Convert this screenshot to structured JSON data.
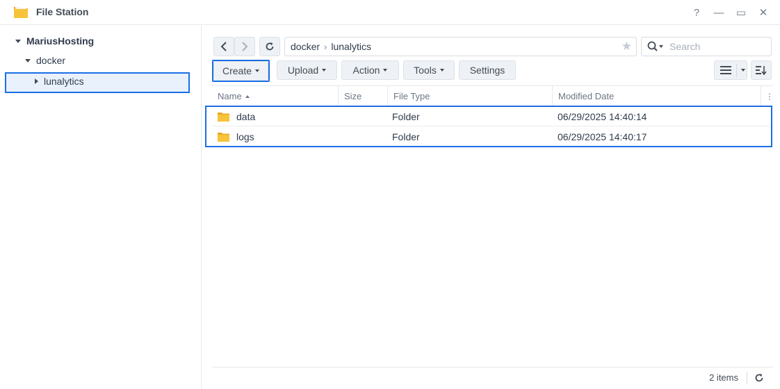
{
  "window": {
    "title": "File Station",
    "controls": [
      "?",
      "—",
      "▭",
      "✕"
    ]
  },
  "sidebar": {
    "items": [
      {
        "label": "MariusHosting",
        "expanded": true,
        "level": 0
      },
      {
        "label": "docker",
        "expanded": true,
        "level": 1
      },
      {
        "label": "lunalytics",
        "expanded": false,
        "level": 2,
        "selected": true
      }
    ]
  },
  "pathbar": {
    "segments": [
      "docker",
      "lunalytics"
    ],
    "separator": "›"
  },
  "search": {
    "placeholder": "Search",
    "value": ""
  },
  "toolbar": {
    "create_label": "Create",
    "upload_label": "Upload",
    "action_label": "Action",
    "tools_label": "Tools",
    "settings_label": "Settings"
  },
  "table": {
    "columns": [
      "Name",
      "Size",
      "File Type",
      "Modified Date"
    ],
    "sort_column": "Name",
    "rows": [
      {
        "name": "data",
        "size": "",
        "type": "Folder",
        "modified": "06/29/2025 14:40:14"
      },
      {
        "name": "logs",
        "size": "",
        "type": "Folder",
        "modified": "06/29/2025 14:40:17"
      }
    ]
  },
  "footer": {
    "item_count": "2 items"
  },
  "colors": {
    "accent": "#1a6ee6",
    "folder": "#f7c33a",
    "selected_bg": "#e8f1fc"
  },
  "icons": {
    "app": "file-station-icon",
    "back": "chevron-left-icon",
    "forward": "chevron-right-icon",
    "refresh": "refresh-icon",
    "star": "star-icon",
    "search": "search-icon",
    "list_view": "list-view-icon",
    "sort": "sort-icon",
    "folder": "folder-icon"
  }
}
